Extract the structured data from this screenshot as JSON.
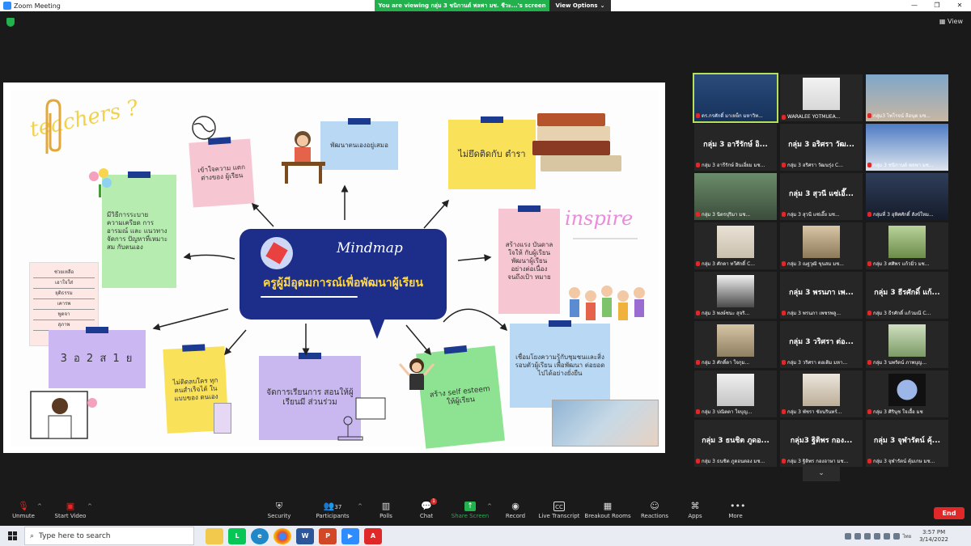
{
  "window": {
    "title": "Zoom Meeting",
    "viewing_banner": "You are viewing กลุ่ม 3 ชนิกานต์ พลพา มช. ชีวะ...'s screen",
    "view_options": "View Options",
    "controls": [
      "—",
      "❐",
      "✕"
    ]
  },
  "top_right": {
    "view_label": "View"
  },
  "slide": {
    "teachers": "teachers ?",
    "inspire": "inspire",
    "mindmap": "Mindmap",
    "center_title": "ครูผู้มีอุดมการณ์เพื่อพัฒนาผู้เรียน",
    "notes": {
      "understand": "เข้าใจความ แตกต่างของ ผู้เรียน",
      "develop_self": "พัฒนาตนเองอยู่เสมอ",
      "not_textbook": "ไม่ยึดติดกับ ตำรา",
      "stress": "มีวิธีการระบาย ความเครียด การอารมณ์ และ แนวทางจัดการ ปัญหาที่เหมาะสม กับตนเอง",
      "inspire_note": "สร้างแรง บันดาลใจให้ กับผู้เรียน พัฒนาผู้เรียน อย่างต่อเนื่อง จนถึงเป้า หมาย",
      "list_items": [
        "ช่วยเหลือ",
        "เอาใจใส่",
        "ยุติธรรม",
        "เคารพ",
        "พูดจา",
        "สุภาพ",
        "ซื่อตรง"
      ],
      "three_two": "3 อ 2 ส 1 ย",
      "no_favor": "ไม่ติดลบใคร ทุกคนสำเร็จได้ ในแบบของ ตนเอง",
      "participation": "จัดการเรียนการ สอนให้ผู้เรียนมี ส่วนร่วม",
      "self_esteem": "สร้าง self esteem ให้ผู้เรียน",
      "community": "เชื่อมโยงความรู้กับชุมชนและสิ่ง รอบตัวผู้เรียน เพื่อพัฒนา ต่อยอดไปได้อย่างยั่งยืน"
    }
  },
  "gallery": {
    "tiles": [
      {
        "name": "",
        "label": "ดร.กรศักดิ์ มาเหย็ก มหาวิท...",
        "video": true,
        "active": true
      },
      {
        "name": "",
        "label": "WARALEE YOTMUEA...",
        "video": true
      },
      {
        "name": "",
        "label": "กลุ่ม3 ไพโรจน์ ลีอนุต มช...",
        "video": true
      },
      {
        "name": "กลุ่ม 3 อารีรักษ์ อิ...",
        "label": "กลุ่ม 3 อารีรักษ์ อินเอี่ยม มช...",
        "video": false
      },
      {
        "name": "กลุ่ม 3 อริศรา วัฒ...",
        "label": "กลุ่ม 3 อริศรา วัฒนรุ่ง C...",
        "video": false
      },
      {
        "name": "",
        "label": "กลุ่ม 3 ชนิกานต์ พลพา มช...",
        "video": true
      },
      {
        "name": "",
        "label": "กลุ่ม 3 นิตรปุริมา มช...",
        "video": true
      },
      {
        "name": "กลุ่ม 3 สุวนี แซ่เอี๊...",
        "label": "กลุ่ม 3 สุวนี แซ่เอี๊ย มช...",
        "video": false
      },
      {
        "name": "",
        "label": "กลุ่มที่ 3 อุทิศศักดิ์ สังข์ใหม...",
        "video": true
      },
      {
        "name": "",
        "label": "กลุ่ม 3 ศักดา ทวีศักดิ์ C...",
        "video": true
      },
      {
        "name": "",
        "label": "กลุ่ม 3 ณฐวุฒิ ขุนสม มช...",
        "video": true
      },
      {
        "name": "",
        "label": "กลุ่ม 3 ศศิพร แก้วมิ่ว มช...",
        "video": true
      },
      {
        "name": "",
        "label": "กลุ่ม 3 พงษ์ชนะ สุจริ...",
        "video": true
      },
      {
        "name": "กลุ่ม 3 พรนภา เพ...",
        "label": "กลุ่ม 3 พรนภา เพชรพลู...",
        "video": false
      },
      {
        "name": "กลุ่ม 3 ธีรศักดิ์ แก้...",
        "label": "กลุ่ม 3 ธีรศักดิ์ แก้วมณี C...",
        "video": false
      },
      {
        "name": "",
        "label": "กลุ่ม 3 ศักดิ์ดา ใจกุม...",
        "video": true
      },
      {
        "name": "กลุ่ม 3 วริศรา ต่อ...",
        "label": "กลุ่ม 3 วริศรา ตอเติม มหา...",
        "video": false
      },
      {
        "name": "",
        "label": "กลุ่ม 3 นพรัตน์ ภาพบุญ...",
        "video": true
      },
      {
        "name": "",
        "label": "กลุ่ม 3 ปณิตตา ใจบุญ...",
        "video": true
      },
      {
        "name": "",
        "label": "กลุ่ม 3 พัชรา ชัยนรินทร์...",
        "video": true
      },
      {
        "name": "",
        "label": "กลุ่ม 3 ศิรินุช ใจเอื้อ มช",
        "video": true
      },
      {
        "name": "กลุ่ม 3 ธนชิต ภูดอ...",
        "label": "กลุ่ม 3 ธนชิต ภูดอนตอง มช...",
        "video": false
      },
      {
        "name": "กลุ่ม3 ฐิติพร กอง...",
        "label": "กลุ่ม 3 ฐิติพร กองอาษา มช...",
        "video": false
      },
      {
        "name": "กลุ่ม 3 จุฬารัตน์ คุ้...",
        "label": "กลุ่ม 3 จุฬารัตน์ คุ้มเกษ มช...",
        "video": false
      }
    ],
    "scroll_icon": "⌄"
  },
  "toolbar": {
    "unmute": "Unmute",
    "start_video": "Start Video",
    "security": "Security",
    "participants": "Participants",
    "participants_count": "37",
    "polls": "Polls",
    "chat": "Chat",
    "chat_badge": "1",
    "share_screen": "Share Screen",
    "record": "Record",
    "live_transcript": "Live Transcript",
    "breakout_rooms": "Breakout Rooms",
    "reactions": "Reactions",
    "apps": "Apps",
    "more": "More",
    "end": "End"
  },
  "taskbar": {
    "search_placeholder": "Type here to search",
    "time": "3:57 PM",
    "date": "3/14/2022",
    "lang": "ไทย"
  },
  "colors": {
    "zoom_blue": "#2d8cff",
    "banner_green": "#22b14c",
    "end_red": "#e02828",
    "mindmap_navy": "#1d2d8a"
  }
}
